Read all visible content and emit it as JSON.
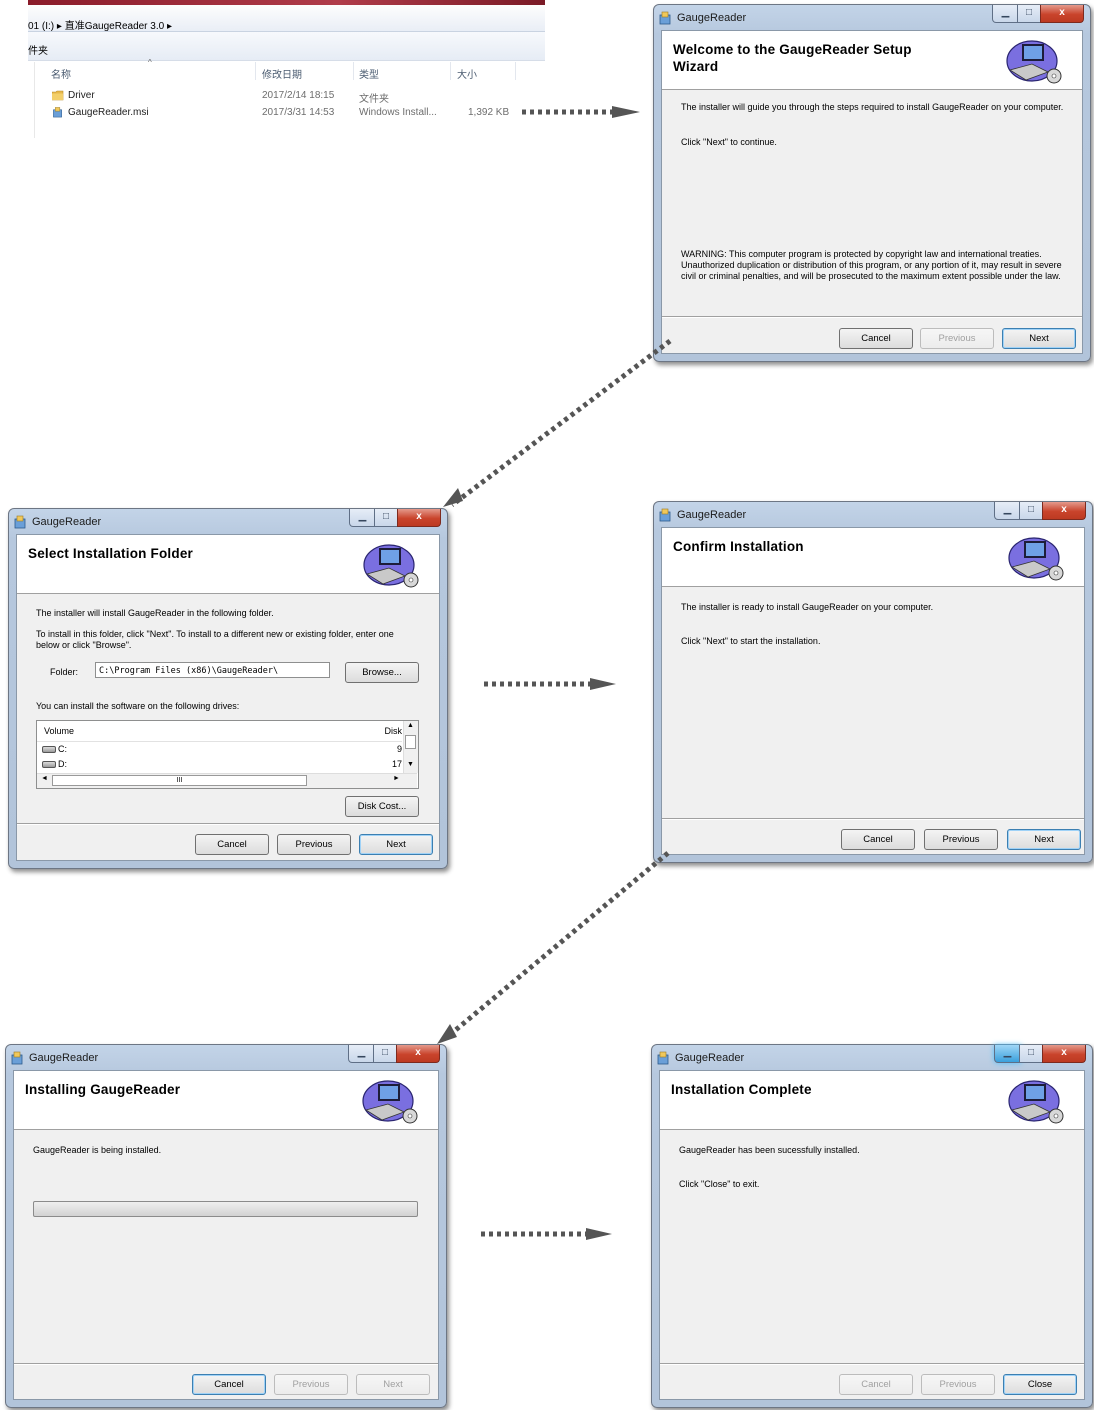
{
  "explorer": {
    "breadcrumb": "01 (I:) ▸ 直准GaugeReader 3.0 ▸",
    "toolbar_label": "件夹",
    "columns": [
      "名称",
      "修改日期",
      "类型",
      "大小"
    ],
    "files": [
      {
        "name": "Driver",
        "date": "2017/2/14 18:15",
        "type": "文件夹",
        "size": ""
      },
      {
        "name": "GaugeReader.msi",
        "date": "2017/3/31 14:53",
        "type": "Windows Install...",
        "size": "1,392 KB"
      }
    ]
  },
  "app_title": "GaugeReader",
  "welcome": {
    "heading": "Welcome to the GaugeReader Setup Wizard",
    "line1": "The installer will guide you through the steps required to install GaugeReader on your computer.",
    "line2": "Click \"Next\" to continue.",
    "warning": "WARNING: This computer program is protected by copyright law and international treaties. Unauthorized duplication or distribution of this program, or any portion of it, may result in severe civil or criminal penalties, and will be prosecuted to the maximum extent possible under the law.",
    "buttons": {
      "cancel": "Cancel",
      "previous": "Previous",
      "next": "Next"
    }
  },
  "folder": {
    "heading": "Select Installation Folder",
    "line1": "The installer will install GaugeReader in the following folder.",
    "line2": "To install in this folder, click \"Next\". To install to a different new or existing folder, enter one below or click \"Browse\".",
    "folder_label": "Folder:",
    "folder_value": "C:\\Program Files (x86)\\GaugeReader\\",
    "browse": "Browse...",
    "drives_label": "You can install the software on the following drives:",
    "volume_col": "Volume",
    "disk_col": "Disk",
    "drives": [
      {
        "name": "C:",
        "disk": "9"
      },
      {
        "name": "D:",
        "disk": "17"
      }
    ],
    "scroll_mark": "III",
    "disk_cost": "Disk Cost...",
    "buttons": {
      "cancel": "Cancel",
      "previous": "Previous",
      "next": "Next"
    }
  },
  "confirm": {
    "heading": "Confirm Installation",
    "line1": "The installer is ready to install GaugeReader on your computer.",
    "line2": "Click \"Next\" to start the installation.",
    "buttons": {
      "cancel": "Cancel",
      "previous": "Previous",
      "next": "Next"
    }
  },
  "installing": {
    "heading": "Installing GaugeReader",
    "line1": "GaugeReader is being installed.",
    "progress": 0,
    "buttons": {
      "cancel": "Cancel",
      "previous": "Previous",
      "next": "Next"
    }
  },
  "complete": {
    "heading": "Installation Complete",
    "line1": "GaugeReader has been sucessfully installed.",
    "line2": "Click \"Close\" to exit.",
    "buttons": {
      "cancel": "Cancel",
      "previous": "Previous",
      "close": "Close"
    }
  },
  "colors": {
    "title_bar": "#b6c8de",
    "close_button": "#c9442c",
    "arrow": "#555555",
    "dialog_bg": "#f0f0f0"
  },
  "icons": [
    "folder-icon",
    "msi-icon",
    "installer-icon",
    "computer-setup-icon",
    "drive-icon"
  ]
}
